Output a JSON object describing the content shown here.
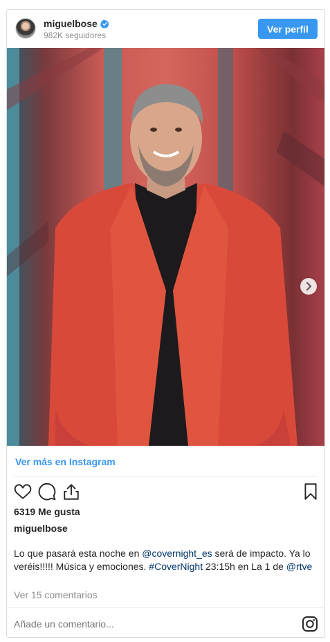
{
  "header": {
    "username": "miguelbose",
    "followers": "982K seguidores",
    "profile_button": "Ver perfil"
  },
  "post": {
    "carousel_dots": 2,
    "carousel_active": 1
  },
  "link": {
    "view_more": "Ver más en Instagram"
  },
  "stats": {
    "likes": "6319 Me gusta"
  },
  "caption": {
    "author": "miguelbose",
    "t1": "Lo que pasará esta noche en ",
    "mention1": "@covernight_es",
    "t2": " será de impacto. Ya lo veréis!!!!! Música y emociones. ",
    "hashtag": "#CoverNight",
    "t3": " 23:15h en La 1 de ",
    "mention2": "@rtve"
  },
  "comments": {
    "view_all": "Ver 15 comentarios",
    "placeholder": "Añade un comentario..."
  },
  "colors": {
    "accent": "#3897f0",
    "tag": "#003569",
    "muted": "#8e8e8e"
  },
  "icons": [
    "avatar",
    "verified-badge-icon",
    "heart-icon",
    "comment-icon",
    "share-icon",
    "bookmark-icon",
    "instagram-logo-icon",
    "chevron-right-icon"
  ]
}
